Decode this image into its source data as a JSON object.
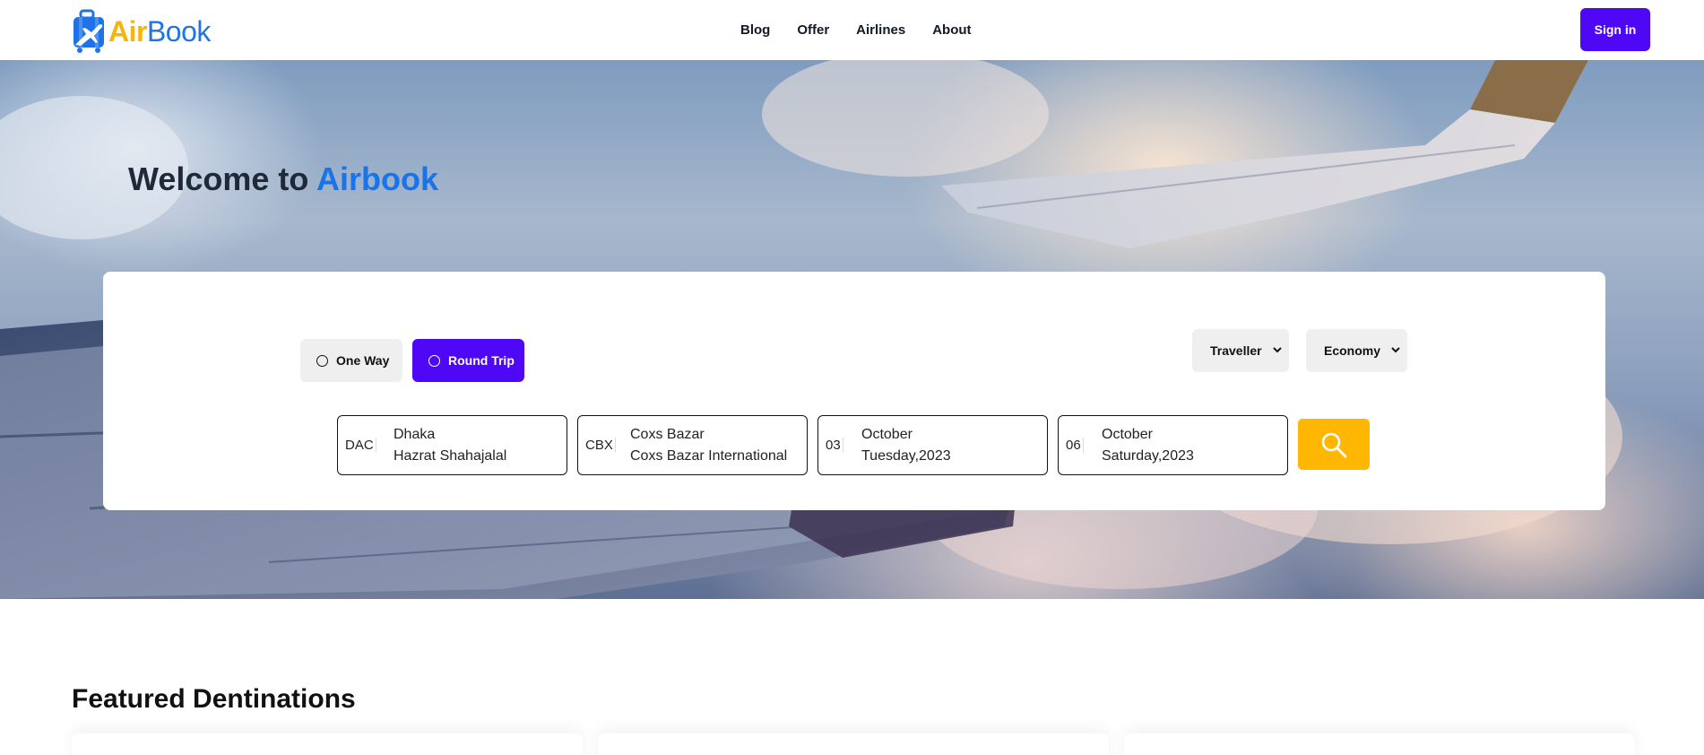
{
  "brand": {
    "part1": "Air",
    "part2": "Book"
  },
  "nav": {
    "links": [
      "Blog",
      "Offer",
      "Airlines",
      "About"
    ],
    "signin": "Sign in"
  },
  "hero": {
    "title_prefix": "Welcome to ",
    "title_accent": "Airbook"
  },
  "trip": {
    "one_way": "One Way",
    "round_trip": "Round Trip",
    "selected": "Round Trip"
  },
  "selects": {
    "traveller": "Traveller",
    "class": "Economy"
  },
  "fields": {
    "from": {
      "code": "DAC",
      "city": "Dhaka",
      "airport": "Hazrat Shahajalal"
    },
    "to": {
      "code": "CBX",
      "city": "Coxs Bazar",
      "airport": "Coxs Bazar International"
    },
    "depart": {
      "day": "03",
      "month": "October",
      "weekday_year": "Tuesday,2023"
    },
    "return": {
      "day": "06",
      "month": "October",
      "weekday_year": "Saturday,2023"
    }
  },
  "featured": {
    "title": "Featured Dentinations"
  },
  "colors": {
    "primary": "#4f08f5",
    "accent": "#ffb703",
    "brand_blue": "#1f73e8",
    "brand_yellow": "#f5b50a"
  }
}
